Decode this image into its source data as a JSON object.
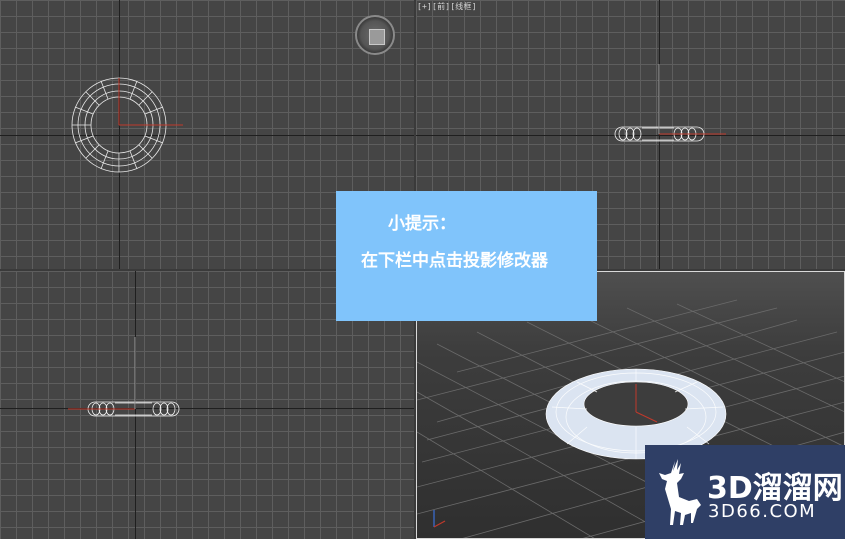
{
  "viewports": {
    "label": "[+][前][线框]",
    "top": "top-left viewport",
    "front": "top-right viewport",
    "left": "bottom-left viewport",
    "perspective": "bottom-right viewport"
  },
  "tip": {
    "title": "小提示：",
    "body": "在下栏中点击投影修改器"
  },
  "watermark": {
    "brand": "3D溜溜网",
    "domain": "3D66.COM"
  }
}
